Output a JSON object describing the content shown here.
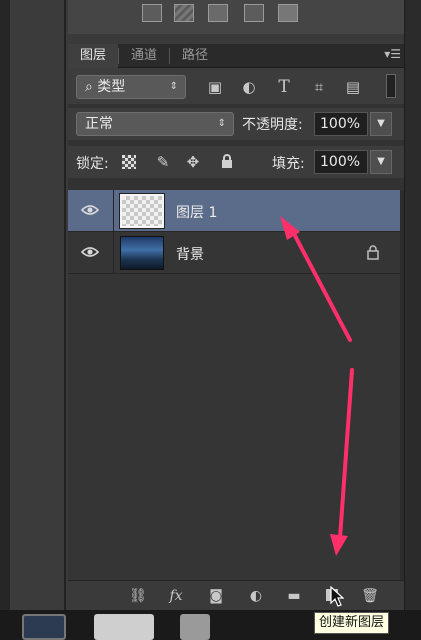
{
  "top_tools": {
    "icons": [
      "warp-icon",
      "hatch-icon",
      "zigzag-icon",
      "x-box-icon",
      "square-icon"
    ]
  },
  "panel": {
    "tabs": [
      {
        "label": "图层",
        "active": true
      },
      {
        "label": "通道",
        "active": false
      },
      {
        "label": "路径",
        "active": false
      }
    ],
    "filter": {
      "label": "类型",
      "prefix_icon": "search-icon"
    },
    "filter_icons": [
      "image-filter-icon",
      "adjustment-filter-icon",
      "T",
      "shape-filter-icon",
      "smart-object-filter-icon"
    ],
    "blend_mode": "正常",
    "opacity_label": "不透明度:",
    "opacity_value": "100%",
    "lock_label": "锁定:",
    "lock_icons": [
      "lock-transparent-icon",
      "lock-paint-icon",
      "lock-position-icon",
      "lock-all-icon"
    ],
    "fill_label": "填充:",
    "fill_value": "100%"
  },
  "layers": [
    {
      "name": "图层 1",
      "selected": true,
      "thumb": "transparent",
      "locked": false,
      "visible": true
    },
    {
      "name": "背景",
      "selected": false,
      "thumb": "photo",
      "locked": true,
      "visible": true
    }
  ],
  "bottom_bar": {
    "icons": [
      "link-icon",
      "fx",
      "mask-icon",
      "adjustment-icon",
      "folder-icon",
      "new-layer-icon",
      "trash-icon"
    ],
    "fx_label": "fx"
  },
  "tooltip": {
    "text": "创建新图层"
  },
  "colors": {
    "selection": "#5b6b8a",
    "annotation_arrow": "#ff2f6a",
    "tooltip_bg": "#ffffe1"
  }
}
